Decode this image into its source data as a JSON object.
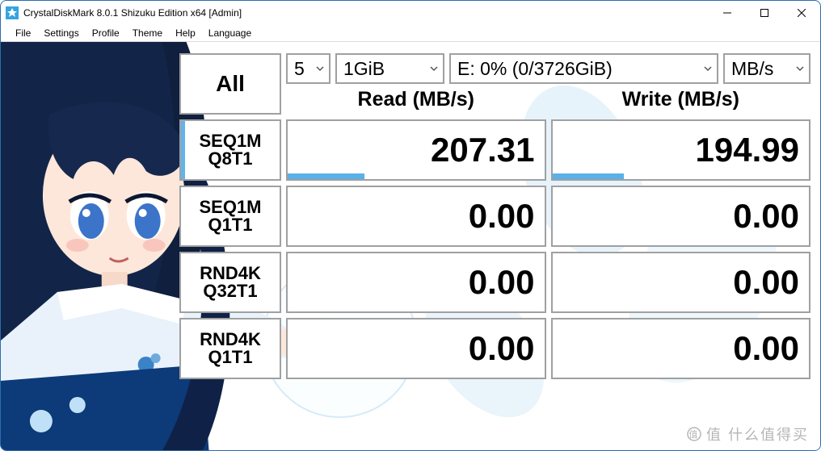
{
  "titlebar": {
    "title": "CrystalDiskMark 8.0.1 Shizuku Edition x64 [Admin]"
  },
  "menu": {
    "items": [
      "File",
      "Settings",
      "Profile",
      "Theme",
      "Help",
      "Language"
    ]
  },
  "config": {
    "all_label": "All",
    "count": "5",
    "size": "1GiB",
    "drive": "E: 0% (0/3726GiB)",
    "unit": "MB/s"
  },
  "headers": {
    "read": "Read (MB/s)",
    "write": "Write (MB/s)"
  },
  "rows": [
    {
      "label1": "SEQ1M",
      "label2": "Q8T1",
      "read": "207.31",
      "write": "194.99",
      "read_bar_pct": 30,
      "write_bar_pct": 28
    },
    {
      "label1": "SEQ1M",
      "label2": "Q1T1",
      "read": "0.00",
      "write": "0.00",
      "read_bar_pct": 0,
      "write_bar_pct": 0
    },
    {
      "label1": "RND4K",
      "label2": "Q32T1",
      "read": "0.00",
      "write": "0.00",
      "read_bar_pct": 0,
      "write_bar_pct": 0
    },
    {
      "label1": "RND4K",
      "label2": "Q1T1",
      "read": "0.00",
      "write": "0.00",
      "read_bar_pct": 0,
      "write_bar_pct": 0
    }
  ],
  "watermark": "值 什么值得买"
}
